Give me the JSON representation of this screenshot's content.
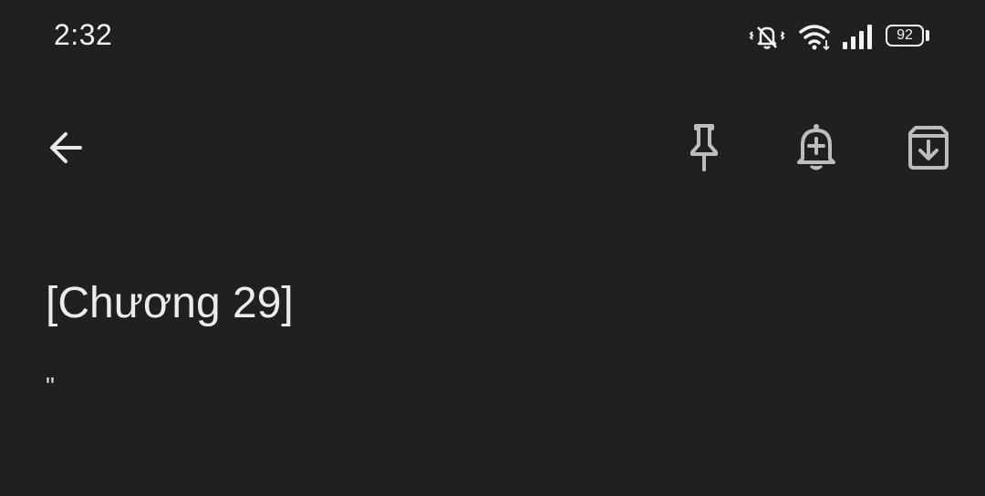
{
  "status_bar": {
    "time": "2:32",
    "battery_level": "92",
    "icons": [
      "vibrate-mute-icon",
      "wifi-icon",
      "cellular-signal-icon",
      "battery-icon"
    ]
  },
  "toolbar": {
    "back_icon": "arrow-left-icon",
    "actions": [
      "pin-icon",
      "reminder-bell-icon",
      "archive-icon"
    ]
  },
  "note": {
    "title": "[Chương 29]",
    "body": "\""
  },
  "colors": {
    "background": "#202020",
    "icon_gray": "#bdbdbd",
    "text": "#ececec"
  }
}
